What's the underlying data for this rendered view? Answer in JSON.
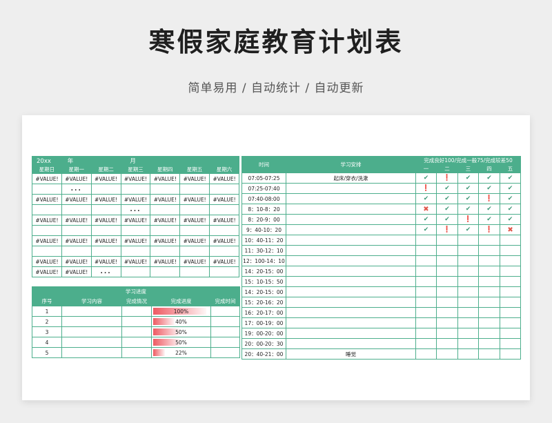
{
  "page": {
    "title": "寒假家庭教育计划表",
    "subtitle": "简单易用 / 自动统计 / 自动更新"
  },
  "calendar": {
    "year_label": "20xx",
    "year_unit": "年",
    "month_unit": "月",
    "weekdays": [
      "星期日",
      "星期一",
      "星期二",
      "星期三",
      "星期四",
      "星期五",
      "星期六"
    ],
    "rows": [
      [
        "#VALUE!",
        "#VALUE!",
        "#VALUE!",
        "#VALUE!",
        "#VALUE!",
        "#VALUE!",
        "#VALUE!"
      ],
      [
        "",
        "...",
        "",
        "",
        "",
        "",
        ""
      ],
      [
        "#VALUE!",
        "#VALUE!",
        "#VALUE!",
        "#VALUE!",
        "#VALUE!",
        "#VALUE!",
        "#VALUE!"
      ],
      [
        "",
        "",
        "",
        "...",
        "",
        "",
        ""
      ],
      [
        "#VALUE!",
        "#VALUE!",
        "#VALUE!",
        "#VALUE!",
        "#VALUE!",
        "#VALUE!",
        "#VALUE!"
      ],
      [
        "",
        "",
        "",
        "",
        "",
        "",
        ""
      ],
      [
        "#VALUE!",
        "#VALUE!",
        "#VALUE!",
        "#VALUE!",
        "#VALUE!",
        "#VALUE!",
        "#VALUE!"
      ],
      [
        "",
        "",
        "",
        "",
        "",
        "",
        ""
      ],
      [
        "#VALUE!",
        "#VALUE!",
        "#VALUE!",
        "#VALUE!",
        "#VALUE!",
        "#VALUE!",
        "#VALUE!"
      ],
      [
        "#VALUE!",
        "#VALUE!",
        "...",
        "",
        "",
        "",
        ""
      ]
    ]
  },
  "progress": {
    "title": "学习进度",
    "headers": [
      "序号",
      "学习内容",
      "完成情况",
      "完成进度",
      "完成时间"
    ],
    "rows": [
      {
        "no": "1",
        "content": "",
        "status": "",
        "progress": 1.0,
        "label": "100%",
        "time": ""
      },
      {
        "no": "2",
        "content": "",
        "status": "",
        "progress": 0.4,
        "label": "40%",
        "time": ""
      },
      {
        "no": "3",
        "content": "",
        "status": "",
        "progress": 0.5,
        "label": "50%",
        "time": ""
      },
      {
        "no": "4",
        "content": "",
        "status": "",
        "progress": 0.5,
        "label": "50%",
        "time": ""
      },
      {
        "no": "5",
        "content": "",
        "status": "",
        "progress": 0.22,
        "label": "22%",
        "time": ""
      }
    ]
  },
  "schedule": {
    "time_header": "时间",
    "plan_header": "学习安排",
    "rating_header": "完成良好100/完成一般75/完成较差50",
    "day_headers": [
      "一",
      "二",
      "三",
      "四",
      "五"
    ],
    "rows": [
      {
        "time": "07:05-07:25",
        "plan": "起床/穿衣/洗漱",
        "marks": [
          "check",
          "warn",
          "check",
          "check",
          "check"
        ]
      },
      {
        "time": "07:25-07:40",
        "plan": "",
        "marks": [
          "warn",
          "check",
          "check",
          "check",
          "check"
        ]
      },
      {
        "time": "07:40-08:00",
        "plan": "",
        "marks": [
          "check",
          "check",
          "check",
          "warn",
          "check"
        ]
      },
      {
        "time": "8：10-8：20",
        "plan": "",
        "marks": [
          "cross",
          "check",
          "check",
          "check",
          "check"
        ]
      },
      {
        "time": "8：20-9：00",
        "plan": "",
        "marks": [
          "check",
          "check",
          "warn",
          "check",
          "check"
        ]
      },
      {
        "time": "9：40-10：20",
        "plan": "",
        "marks": [
          "check",
          "warn",
          "check",
          "warn",
          "cross"
        ]
      },
      {
        "time": "10：40-11：20",
        "plan": "",
        "marks": [
          "",
          "",
          "",
          "",
          ""
        ]
      },
      {
        "time": "11：30-12：10",
        "plan": "",
        "marks": [
          "",
          "",
          "",
          "",
          ""
        ]
      },
      {
        "time": "12：100-14：10",
        "plan": "",
        "marks": [
          "",
          "",
          "",
          "",
          ""
        ]
      },
      {
        "time": "14：20-15：00",
        "plan": "",
        "marks": [
          "",
          "",
          "",
          "",
          ""
        ]
      },
      {
        "time": "15：10-15：50",
        "plan": "",
        "marks": [
          "",
          "",
          "",
          "",
          ""
        ]
      },
      {
        "time": "14：20-15：00",
        "plan": "",
        "marks": [
          "",
          "",
          "",
          "",
          ""
        ]
      },
      {
        "time": "15：20-16：20",
        "plan": "",
        "marks": [
          "",
          "",
          "",
          "",
          ""
        ]
      },
      {
        "time": "16：20-17：00",
        "plan": "",
        "marks": [
          "",
          "",
          "",
          "",
          ""
        ]
      },
      {
        "time": "17：00-19：00",
        "plan": "",
        "marks": [
          "",
          "",
          "",
          "",
          ""
        ]
      },
      {
        "time": "19：00-20：00",
        "plan": "",
        "marks": [
          "",
          "",
          "",
          "",
          ""
        ]
      },
      {
        "time": "20：00-20：30",
        "plan": "",
        "marks": [
          "",
          "",
          "",
          "",
          ""
        ]
      },
      {
        "time": "20：40-21：00",
        "plan": "睡觉",
        "marks": [
          "",
          "",
          "",
          "",
          ""
        ]
      }
    ]
  },
  "icons": {
    "check": "✔",
    "warn": "❗",
    "cross": "✖"
  },
  "colors": {
    "accent": "#4cae8c",
    "bar": "#ee5a62",
    "check": "#3f9a78",
    "warn": "#f3a23a",
    "cross": "#e0564a"
  }
}
